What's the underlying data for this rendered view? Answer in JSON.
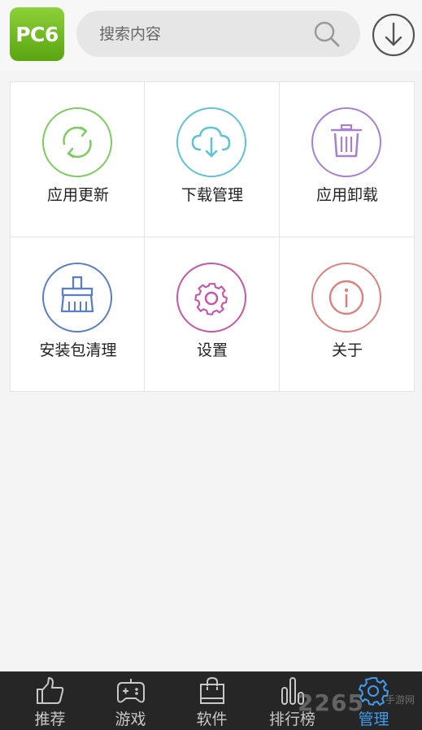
{
  "header": {
    "logo_text": "PC6",
    "search_placeholder": "搜索内容"
  },
  "grid": {
    "items": [
      {
        "label": "应用更新",
        "icon": "refresh-icon",
        "color": "#7ccc5e"
      },
      {
        "label": "下载管理",
        "icon": "cloud-download-icon",
        "color": "#5ec3d6"
      },
      {
        "label": "应用卸载",
        "icon": "trash-icon",
        "color": "#a87fd6"
      },
      {
        "label": "安装包清理",
        "icon": "broom-icon",
        "color": "#5a7fc8"
      },
      {
        "label": "设置",
        "icon": "gear-icon",
        "color": "#c756a8"
      },
      {
        "label": "关于",
        "icon": "info-icon",
        "color": "#e07f7f"
      }
    ]
  },
  "tabbar": {
    "tabs": [
      {
        "label": "推荐",
        "icon": "thumbs-up-icon"
      },
      {
        "label": "游戏",
        "icon": "gamepad-icon"
      },
      {
        "label": "软件",
        "icon": "bag-icon"
      },
      {
        "label": "排行榜",
        "icon": "bar-chart-icon"
      },
      {
        "label": "管理",
        "icon": "gear-icon",
        "active": true
      }
    ],
    "active_color": "#3e9ded"
  },
  "watermark": {
    "brand": "2265",
    "tag": "手游网"
  }
}
